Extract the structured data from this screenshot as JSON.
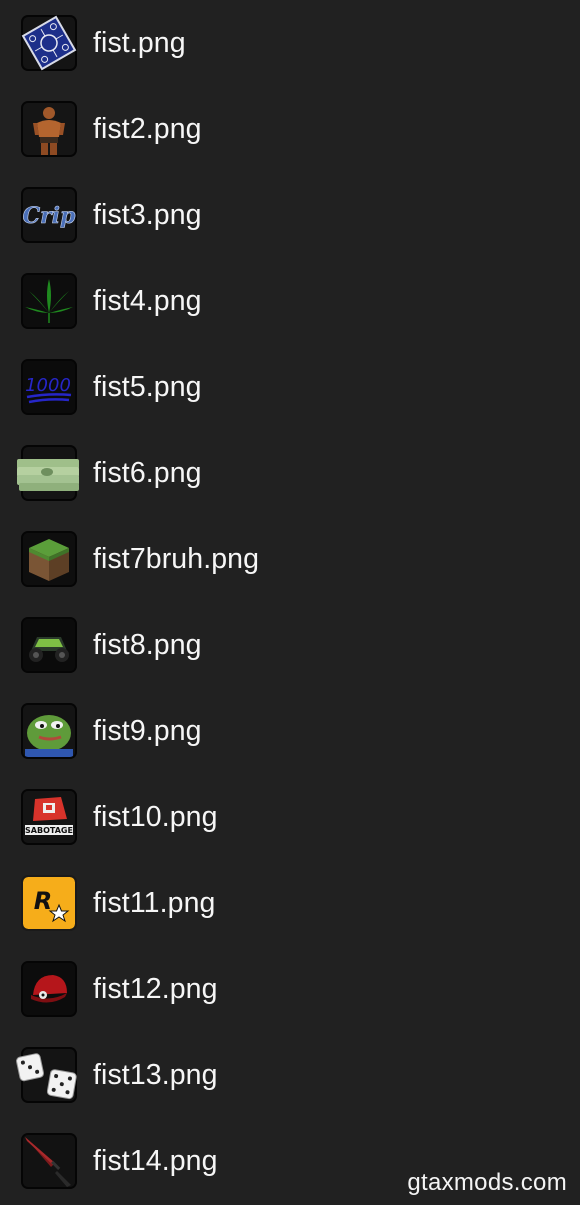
{
  "files": [
    {
      "name": "fist.png",
      "icon": "bandana-icon"
    },
    {
      "name": "fist2.png",
      "icon": "figure-icon"
    },
    {
      "name": "fist3.png",
      "icon": "crip-text-icon"
    },
    {
      "name": "fist4.png",
      "icon": "leaf-icon"
    },
    {
      "name": "fist5.png",
      "icon": "hundred-icon"
    },
    {
      "name": "fist6.png",
      "icon": "cash-stack-icon"
    },
    {
      "name": "fist7bruh.png",
      "icon": "grass-block-icon"
    },
    {
      "name": "fist8.png",
      "icon": "green-car-icon"
    },
    {
      "name": "fist9.png",
      "icon": "frog-icon"
    },
    {
      "name": "fist10.png",
      "icon": "sabotage-logo-icon"
    },
    {
      "name": "fist11.png",
      "icon": "rockstar-logo-icon"
    },
    {
      "name": "fist12.png",
      "icon": "red-cap-icon"
    },
    {
      "name": "fist13.png",
      "icon": "dice-icon"
    },
    {
      "name": "fist14.png",
      "icon": "knife-icon"
    }
  ],
  "thumb_labels": {
    "crip": "Crip",
    "hundred": "1000",
    "sabotage": "SABOTAGE",
    "rockstar": "R"
  },
  "watermark": "gtaxmods.com"
}
